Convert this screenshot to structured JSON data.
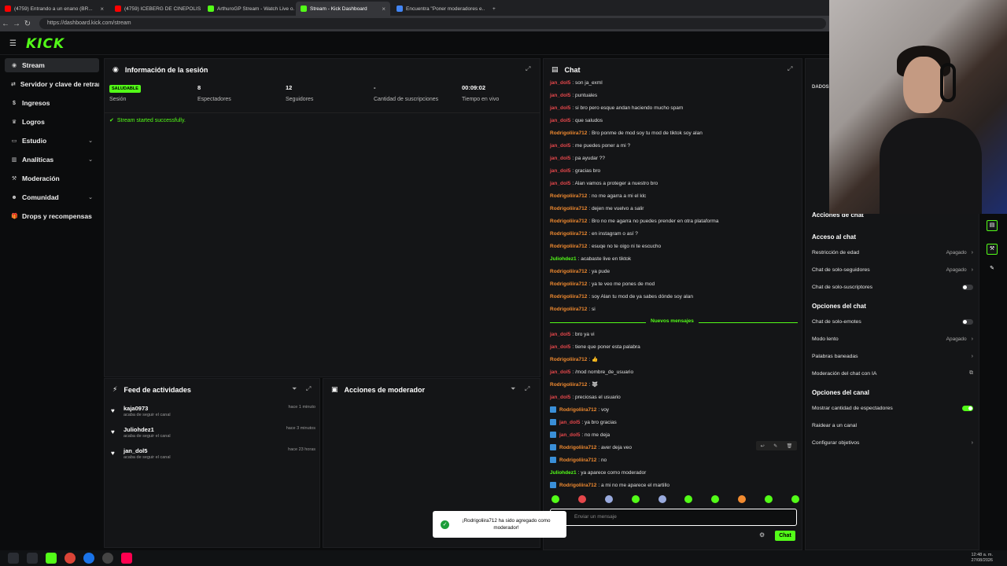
{
  "browser": {
    "tabs": [
      {
        "label": "(4759) Entrando a un enano (BR...",
        "fav": "#ff0000"
      },
      {
        "label": "(4759) ICEBERG DE CINEPOLIS | M...",
        "fav": "#ff0000"
      },
      {
        "label": "ArthuroGP Stream - Watch Live o...",
        "fav": "#53fc18"
      },
      {
        "label": "Stream - Kick Dashboard",
        "fav": "#53fc18"
      },
      {
        "label": "Encuentra \"Poner moderadores e...",
        "fav": "#4285f4"
      }
    ],
    "url": "https://dashboard.kick.com/stream"
  },
  "header": {
    "logo": "KICK"
  },
  "sidebar": {
    "items": [
      {
        "label": "Stream",
        "icon": "broadcast-icon",
        "active": true,
        "chevron": false
      },
      {
        "label": "Servidor y clave de retransmisión",
        "icon": "key-icon",
        "active": false,
        "chevron": false
      },
      {
        "label": "Ingresos",
        "icon": "money-icon",
        "active": false,
        "chevron": false
      },
      {
        "label": "Logros",
        "icon": "trophy-icon",
        "active": false,
        "chevron": false
      },
      {
        "label": "Estudio",
        "icon": "studio-icon",
        "active": false,
        "chevron": true
      },
      {
        "label": "Analíticas",
        "icon": "chart-icon",
        "active": false,
        "chevron": true
      },
      {
        "label": "Moderación",
        "icon": "hammer-icon",
        "active": false,
        "chevron": false
      },
      {
        "label": "Comunidad",
        "icon": "people-icon",
        "active": false,
        "chevron": true
      },
      {
        "label": "Drops y recompensas",
        "icon": "gift-icon",
        "active": false,
        "chevron": false
      }
    ]
  },
  "session": {
    "title": "Información de la sesión",
    "badge": "SALUDABLE",
    "stats": [
      {
        "value": "",
        "label": "Sesión"
      },
      {
        "value": "8",
        "label": "Espectadores"
      },
      {
        "value": "12",
        "label": "Seguidores"
      },
      {
        "value": "-",
        "label": "Cantidad de suscripciones"
      },
      {
        "value": "00:09:02",
        "label": "Tiempo en vivo"
      }
    ],
    "status": "Stream started successfully."
  },
  "feed": {
    "title": "Feed de actividades",
    "items": [
      {
        "name": "kaja0973",
        "sub": "acaba de seguir el canal",
        "time": "hace 1 minuto"
      },
      {
        "name": "Juliohdez1",
        "sub": "acaba de seguir el canal",
        "time": "hace 3 minutos"
      },
      {
        "name": "jan_dol5",
        "sub": "acaba de seguir el canal",
        "time": "hace 23 horas"
      }
    ]
  },
  "modactions": {
    "title": "Acciones de moderador"
  },
  "chat": {
    "title": "Chat",
    "new_messages": "Nuevos mensajes",
    "messages_before": [
      {
        "user": "jan_dol5",
        "color": "#e5474b",
        "text": ": son ja_exml",
        "mod": false
      },
      {
        "user": "jan_dol5",
        "color": "#e5474b",
        "text": ": puntuales",
        "mod": false
      },
      {
        "user": "jan_dol5",
        "color": "#e5474b",
        "text": ": si bro pero esque andan haciendo mucho spam",
        "mod": false
      },
      {
        "user": "jan_dol5",
        "color": "#e5474b",
        "text": ": que saludos",
        "mod": false
      },
      {
        "user": "Rodrigoliira712",
        "color": "#f28b30",
        "text": ": Bro ponme de mod soy tu mod de tiktok soy alan",
        "mod": false
      },
      {
        "user": "jan_dol5",
        "color": "#e5474b",
        "text": ": me puedes poner a mi ?",
        "mod": false
      },
      {
        "user": "jan_dol5",
        "color": "#e5474b",
        "text": ": pa ayudar ??",
        "mod": false
      },
      {
        "user": "jan_dol5",
        "color": "#e5474b",
        "text": ": gracias bro",
        "mod": false
      },
      {
        "user": "jan_dol5",
        "color": "#e5474b",
        "text": ": Alan vamos a proteger a nuestro bro",
        "mod": false
      },
      {
        "user": "Rodrigoliira712",
        "color": "#f28b30",
        "text": ": no me agarra a mi el klc",
        "mod": false
      },
      {
        "user": "Rodrigoliira712",
        "color": "#f28b30",
        "text": ": dejen me vuelvo a salir",
        "mod": false
      },
      {
        "user": "Rodrigoliira712",
        "color": "#f28b30",
        "text": ": Bro no me agarra no puedes prender en otra plataforma",
        "mod": false
      },
      {
        "user": "Rodrigoliira712",
        "color": "#f28b30",
        "text": ": en instagram o así ?",
        "mod": false
      },
      {
        "user": "Rodrigoliira712",
        "color": "#f28b30",
        "text": ": esuqe no te oigo ni te escucho",
        "mod": false
      },
      {
        "user": "Juliohdez1",
        "color": "#53fc18",
        "text": ": acabaste live en tiktok",
        "mod": false
      },
      {
        "user": "Rodrigoliira712",
        "color": "#f28b30",
        "text": ": ya pude",
        "mod": false
      },
      {
        "user": "Rodrigoliira712",
        "color": "#f28b30",
        "text": ": ya te veo me pones de mod",
        "mod": false
      },
      {
        "user": "Rodrigoliira712",
        "color": "#f28b30",
        "text": ": soy Alan tu mod de ya sabes dónde soy alan",
        "mod": false
      },
      {
        "user": "Rodrigoliira712",
        "color": "#f28b30",
        "text": ": si",
        "mod": false
      }
    ],
    "messages_after": [
      {
        "user": "jan_dol5",
        "color": "#e5474b",
        "text": ": bro ya vi",
        "mod": false
      },
      {
        "user": "jan_dol5",
        "color": "#e5474b",
        "text": ": tiene que poner esta palabra",
        "mod": false
      },
      {
        "user": "Rodrigoliira712",
        "color": "#f28b30",
        "text": ": 👍",
        "mod": false
      },
      {
        "user": "jan_dol5",
        "color": "#e5474b",
        "text": ": /mod nombre_de_usuario",
        "mod": false
      },
      {
        "user": "Rodrigoliira712",
        "color": "#f28b30",
        "text": ": 🐺",
        "mod": false
      },
      {
        "user": "jan_dol5",
        "color": "#e5474b",
        "text": ": preciosas el usuario",
        "mod": false
      },
      {
        "user": "Rodrigoliira712",
        "color": "#f28b30",
        "text": ": voy",
        "mod": true
      },
      {
        "user": "jan_dol5",
        "color": "#e5474b",
        "text": ": ya bro gracias",
        "mod": true
      },
      {
        "user": "jan_dol5",
        "color": "#e5474b",
        "text": ": no me deja",
        "mod": true
      },
      {
        "user": "Rodrigoliira712",
        "color": "#f28b30",
        "text": ": aver deja veo",
        "mod": true
      },
      {
        "user": "Rodrigoliira712",
        "color": "#f28b30",
        "text": ": no",
        "mod": true
      },
      {
        "user": "Juliohdez1",
        "color": "#53fc18",
        "text": ": ya aparece como moderador",
        "mod": false
      },
      {
        "user": "Rodrigoliira712",
        "color": "#f28b30",
        "text": ": a mi no me aparece el martillo",
        "mod": true
      }
    ],
    "input_placeholder": "Enviar un mensaje",
    "send_label": "Chat"
  },
  "right_panel": {
    "title": "Acciones de chat",
    "partial_label": "DADOS",
    "sections": [
      {
        "heading": "Acceso al chat",
        "items": [
          {
            "label": "Restricción de edad",
            "value": "Apagado",
            "type": "select"
          },
          {
            "label": "Chat de solo-seguidores",
            "value": "Apagado",
            "type": "select"
          },
          {
            "label": "Chat de solo-suscriptores",
            "value": "",
            "type": "toggle",
            "on": false
          }
        ]
      },
      {
        "heading": "Opciones del chat",
        "items": [
          {
            "label": "Chat de solo-emotes",
            "value": "",
            "type": "toggle",
            "on": false
          },
          {
            "label": "Modo lento",
            "value": "Apagado",
            "type": "select"
          },
          {
            "label": "Palabras baneadas",
            "value": "",
            "type": "link"
          },
          {
            "label": "Moderación del chat con IA",
            "value": "",
            "type": "external"
          }
        ]
      },
      {
        "heading": "Opciones del canal",
        "items": [
          {
            "label": "Mostrar cantidad de espectadores",
            "value": "",
            "type": "toggle",
            "on": true
          },
          {
            "label": "Raidear a un canal",
            "value": "",
            "type": "plain"
          },
          {
            "label": "Configurar objetivos",
            "value": "",
            "type": "link"
          }
        ]
      }
    ]
  },
  "toast": {
    "text": "¡Rodrigoliira712 ha sido agregado como moderador!"
  },
  "taskbar": {
    "time": "12:48 a. m.",
    "date": "27/08/2026"
  },
  "colors": {
    "accent": "#53fc18"
  }
}
